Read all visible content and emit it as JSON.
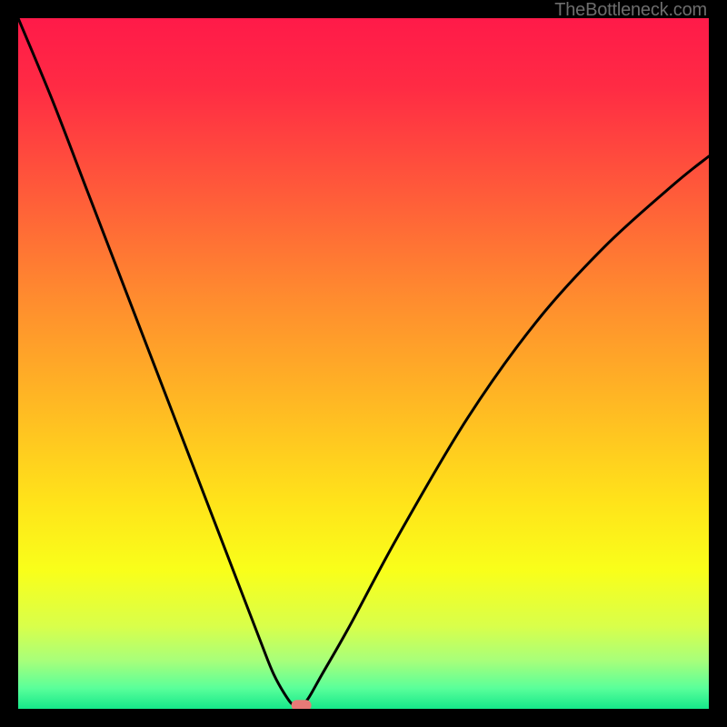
{
  "watermark": "TheBottleneck.com",
  "chart_data": {
    "type": "line",
    "title": "",
    "xlabel": "",
    "ylabel": "",
    "xlim": [
      0,
      100
    ],
    "ylim": [
      0,
      100
    ],
    "x": [
      0,
      5,
      10,
      15,
      20,
      25,
      30,
      35,
      37,
      39,
      40,
      41,
      42,
      44,
      48,
      55,
      65,
      75,
      85,
      95,
      100
    ],
    "values": [
      100,
      88,
      75,
      62,
      49,
      36,
      23,
      10,
      5,
      1.5,
      0.5,
      0.5,
      1.5,
      5,
      12,
      25,
      42,
      56,
      67,
      76,
      80
    ],
    "marker": {
      "x": 41,
      "y": 0.5
    },
    "gradient_stops": [
      {
        "offset": 0.0,
        "color": "#ff1a49"
      },
      {
        "offset": 0.1,
        "color": "#ff2b44"
      },
      {
        "offset": 0.25,
        "color": "#ff5a3a"
      },
      {
        "offset": 0.4,
        "color": "#ff8a2f"
      },
      {
        "offset": 0.55,
        "color": "#ffb624"
      },
      {
        "offset": 0.7,
        "color": "#ffe31a"
      },
      {
        "offset": 0.8,
        "color": "#f9ff1a"
      },
      {
        "offset": 0.88,
        "color": "#d9ff4a"
      },
      {
        "offset": 0.93,
        "color": "#a8ff7a"
      },
      {
        "offset": 0.97,
        "color": "#5aff9a"
      },
      {
        "offset": 1.0,
        "color": "#15e88a"
      }
    ],
    "marker_color": "#e77a77",
    "curve_color": "#000000",
    "curve_width": 3
  }
}
